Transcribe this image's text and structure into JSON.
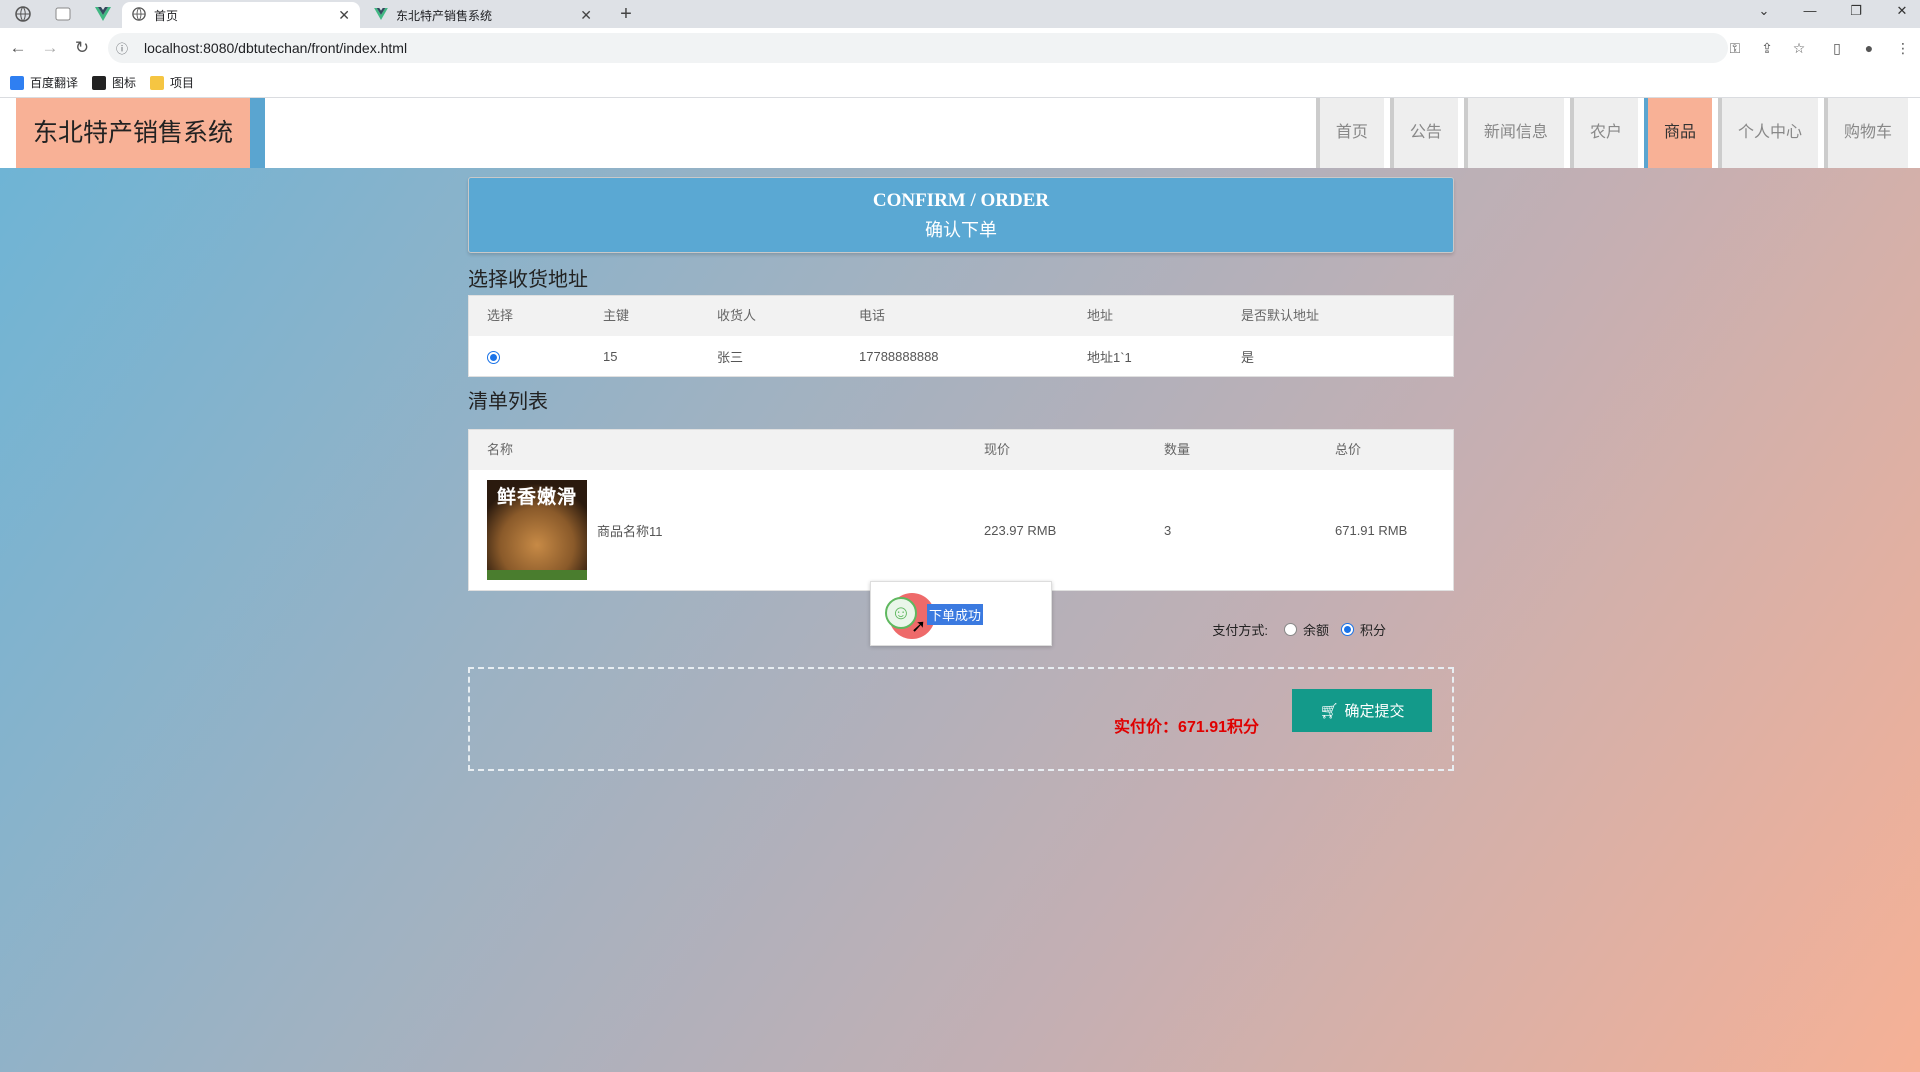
{
  "browser": {
    "tabs": [
      {
        "title": "首页",
        "active": true
      },
      {
        "title": "东北特产销售系统",
        "active": false
      }
    ],
    "url": "localhost:8080/dbtutechan/front/index.html",
    "bookmarks": [
      {
        "label": "百度翻译",
        "icon": "baidu-translate-icon",
        "color": "#2f7ff1"
      },
      {
        "label": "图标",
        "icon": "folder-dark-icon",
        "color": "#222222"
      },
      {
        "label": "项目",
        "icon": "folder-icon",
        "color": "#f5c542"
      }
    ]
  },
  "site": {
    "logo": "东北特产销售系统",
    "nav": [
      {
        "label": "首页",
        "active": false
      },
      {
        "label": "公告",
        "active": false
      },
      {
        "label": "新闻信息",
        "active": false
      },
      {
        "label": "农户",
        "active": false
      },
      {
        "label": "商品",
        "active": true
      },
      {
        "label": "个人中心",
        "active": false
      },
      {
        "label": "购物车",
        "active": false
      }
    ]
  },
  "banner": {
    "en": "CONFIRM / ORDER",
    "cn": "确认下单"
  },
  "address_section": {
    "title": "选择收货地址",
    "headers": [
      "选择",
      "主键",
      "收货人",
      "电话",
      "地址",
      "是否默认地址"
    ],
    "rows": [
      {
        "selected": true,
        "id": "15",
        "receiver": "张三",
        "phone": "17788888888",
        "address": "地址1`1",
        "default": "是"
      }
    ]
  },
  "order_section": {
    "title": "清单列表",
    "headers": [
      "名称",
      "现价",
      "数量",
      "总价"
    ],
    "items": [
      {
        "image_text": "鲜香嫩滑",
        "name": "商品名称11",
        "price": "223.97 RMB",
        "qty": "3",
        "total": "671.91 RMB"
      }
    ]
  },
  "payment": {
    "label": "支付方式:",
    "options": [
      {
        "label": "余额",
        "selected": false
      },
      {
        "label": "积分",
        "selected": true
      }
    ]
  },
  "toast": {
    "message": "下单成功"
  },
  "summary": {
    "total_text": "实付价：671.91积分",
    "submit_label": "确定提交"
  },
  "colors": {
    "accent": "#5aa8d3",
    "logo_bg": "#f8b196",
    "submit": "#139a8a",
    "total": "#e00000"
  }
}
